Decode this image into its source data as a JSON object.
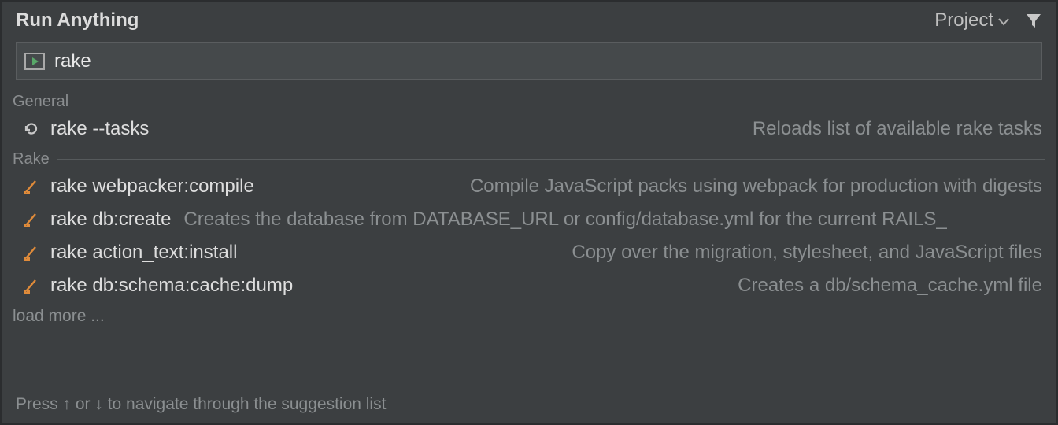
{
  "header": {
    "title": "Run Anything",
    "scope_label": "Project"
  },
  "search": {
    "value": "rake",
    "placeholder": ""
  },
  "sections": [
    {
      "name": "General",
      "items": [
        {
          "icon": "refresh-icon",
          "command": "rake --tasks",
          "description": "Reloads list of available rake tasks",
          "inline": false
        }
      ]
    },
    {
      "name": "Rake",
      "items": [
        {
          "icon": "rake-icon",
          "command": "rake webpacker:compile",
          "description": "Compile JavaScript packs using webpack for production with digests",
          "inline": false
        },
        {
          "icon": "rake-icon",
          "command": "rake db:create",
          "description": "Creates the database from DATABASE_URL or config/database.yml for the current RAILS_",
          "inline": true
        },
        {
          "icon": "rake-icon",
          "command": "rake action_text:install",
          "description": "Copy over the migration, stylesheet, and JavaScript files",
          "inline": false
        },
        {
          "icon": "rake-icon",
          "command": "rake db:schema:cache:dump",
          "description": "Creates a db/schema_cache.yml file",
          "inline": false
        }
      ]
    }
  ],
  "load_more": "load more ...",
  "footer_hint": "Press ↑ or ↓ to navigate through the suggestion list"
}
